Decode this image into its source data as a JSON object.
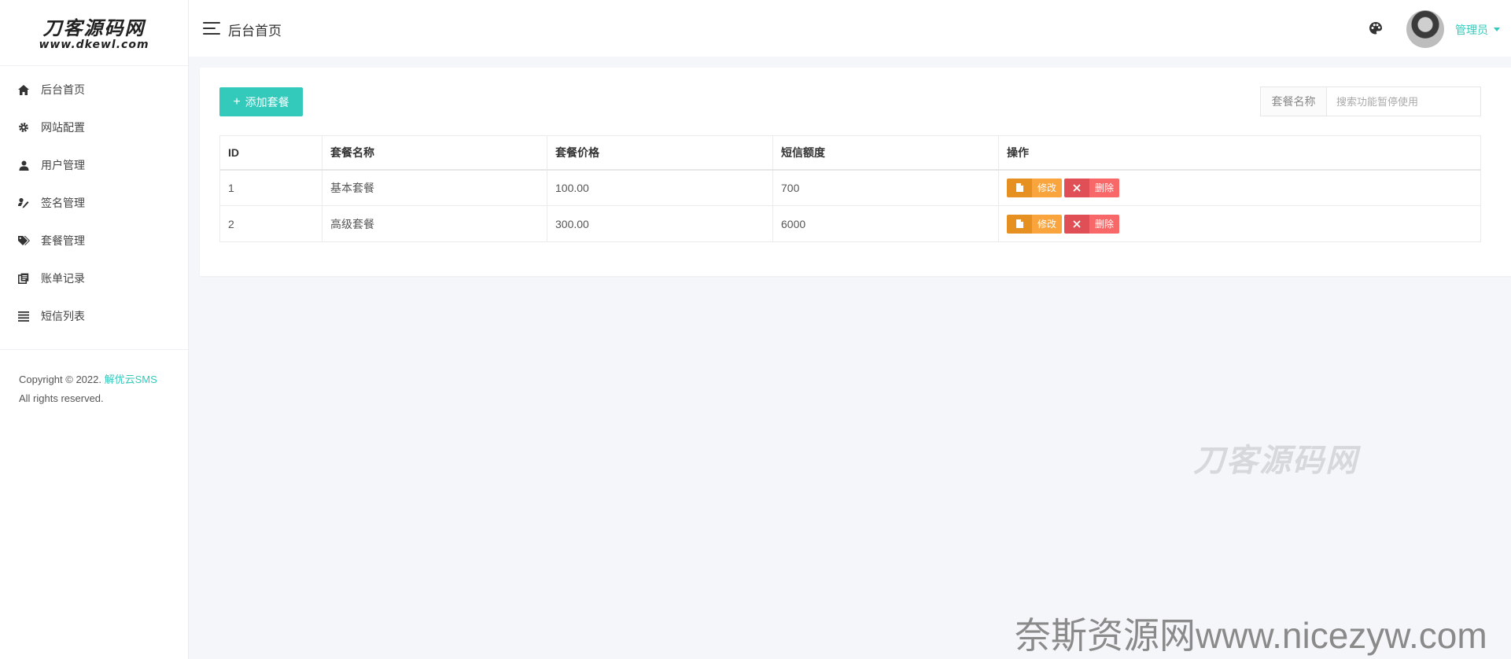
{
  "logo": {
    "title": "刀客源码网",
    "url": "www.dkewl.com"
  },
  "sidebar": {
    "items": [
      {
        "label": "后台首页",
        "icon": "home-icon"
      },
      {
        "label": "网站配置",
        "icon": "gear-icon"
      },
      {
        "label": "用户管理",
        "icon": "user-icon"
      },
      {
        "label": "签名管理",
        "icon": "signature-icon"
      },
      {
        "label": "套餐管理",
        "icon": "tags-icon"
      },
      {
        "label": "账单记录",
        "icon": "bill-icon"
      },
      {
        "label": "短信列表",
        "icon": "list-icon"
      }
    ],
    "copyright": {
      "prefix": "Copyright © 2022.",
      "brand": "解优云SMS",
      "rights": "All rights reserved."
    }
  },
  "header": {
    "title": "后台首页",
    "user": "管理员"
  },
  "toolbar": {
    "add_label": "添加套餐"
  },
  "search": {
    "label": "套餐名称",
    "placeholder": "搜索功能暂停使用"
  },
  "table": {
    "headers": [
      "ID",
      "套餐名称",
      "套餐价格",
      "短信额度",
      "操作"
    ],
    "rows": [
      {
        "id": "1",
        "name": "基本套餐",
        "price": "100.00",
        "quota": "700"
      },
      {
        "id": "2",
        "name": "高级套餐",
        "price": "300.00",
        "quota": "6000"
      }
    ],
    "edit_label": "修改",
    "delete_label": "删除"
  },
  "watermarks": {
    "site_logo": "刀客源码网",
    "footer": "奈斯资源网www.nicezyw.com"
  },
  "colors": {
    "accent": "#33cabb",
    "edit": "#f9a43c",
    "delete": "#f96868"
  }
}
